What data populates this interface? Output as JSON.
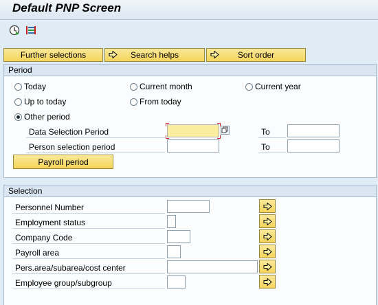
{
  "window": {
    "title": "Default PNP Screen"
  },
  "toolbar": {
    "execute_icon": "execute-clock-icon",
    "layout_icon": "layout-bars-icon"
  },
  "buttons": {
    "further_selections": "Further selections",
    "search_helps": "Search helps",
    "sort_order": "Sort order"
  },
  "period": {
    "heading": "Period",
    "options": [
      "Today",
      "Current month",
      "Current year",
      "Up to today",
      "From today",
      "Other period"
    ],
    "selected": "Other period",
    "data_selection_label": "Data Selection Period",
    "person_selection_label": "Person selection period",
    "to_label": "To",
    "data_from": "",
    "data_to": "",
    "person_from": "",
    "person_to": "",
    "payroll_button": "Payroll period"
  },
  "selection": {
    "heading": "Selection",
    "fields": [
      {
        "label": "Personnel Number",
        "value": ""
      },
      {
        "label": "Employment status",
        "value": ""
      },
      {
        "label": "Company Code",
        "value": ""
      },
      {
        "label": "Payroll area",
        "value": ""
      },
      {
        "label": "Pers.area/subarea/cost center",
        "value": ""
      },
      {
        "label": "Employee group/subgroup",
        "value": ""
      }
    ]
  },
  "colors": {
    "background": "#dfebf5",
    "button_yellow": "#f4d45a",
    "required_field": "#fbeda0",
    "section_header": "#d9e6f1"
  }
}
